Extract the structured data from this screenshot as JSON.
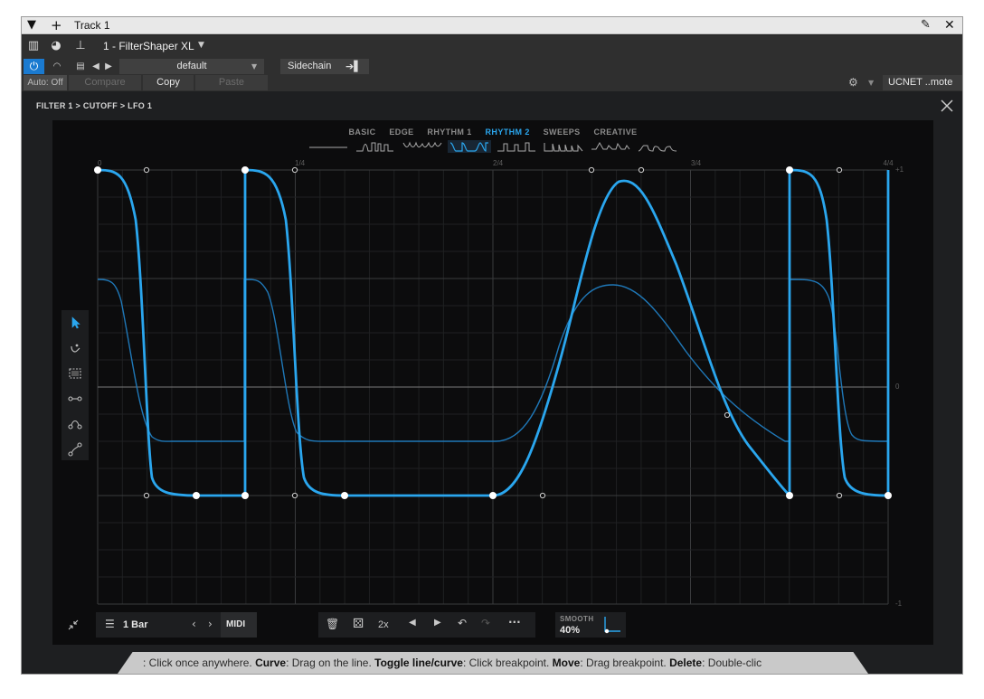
{
  "titlebar": {
    "title": "Track 1"
  },
  "header": {
    "plugin_name": "1 - FilterShaper XL",
    "preset": "default",
    "sidechain": "Sidechain",
    "auto_off": "Auto: Off",
    "compare": "Compare",
    "copy": "Copy",
    "paste": "Paste",
    "remote": "UCNET ..mote"
  },
  "breadcrumb": "FILTER 1 > CUTOFF > LFO 1",
  "tabs": [
    {
      "label": "BASIC",
      "active": false
    },
    {
      "label": "EDGE",
      "active": false
    },
    {
      "label": "RHYTHM 1",
      "active": false
    },
    {
      "label": "RHYTHM 2",
      "active": true
    },
    {
      "label": "SWEEPS",
      "active": false
    },
    {
      "label": "CREATIVE",
      "active": false
    }
  ],
  "grid": {
    "top_labels": [
      "0",
      "1/4",
      "2/4",
      "3/4",
      "4/4"
    ],
    "right_labels": [
      "+1",
      "0",
      "-1"
    ]
  },
  "tools": [
    "pointer-icon",
    "paint-icon",
    "select-icon",
    "line-icon",
    "curve-icon",
    "diagonal-icon"
  ],
  "bottom": {
    "length": "1 Bar",
    "midi": "MIDI",
    "multiply": "2x",
    "smooth_label": "SMOOTH",
    "smooth_value": "40%"
  },
  "status": {
    "parts": [
      {
        "bold": false,
        "text": ": Click once anywhere. "
      },
      {
        "bold": true,
        "text": "Curve"
      },
      {
        "bold": false,
        "text": ": Drag on the line. "
      },
      {
        "bold": true,
        "text": "Toggle line/curve"
      },
      {
        "bold": false,
        "text": ": Click breakpoint. "
      },
      {
        "bold": true,
        "text": "Move"
      },
      {
        "bold": false,
        "text": ": Drag breakpoint. "
      },
      {
        "bold": true,
        "text": "Delete"
      },
      {
        "bold": false,
        "text": ": Double-clic"
      }
    ]
  },
  "colors": {
    "accent": "#2aa6ee",
    "curve_dim": "#1f78b8",
    "panel": "#0c0c0d"
  }
}
